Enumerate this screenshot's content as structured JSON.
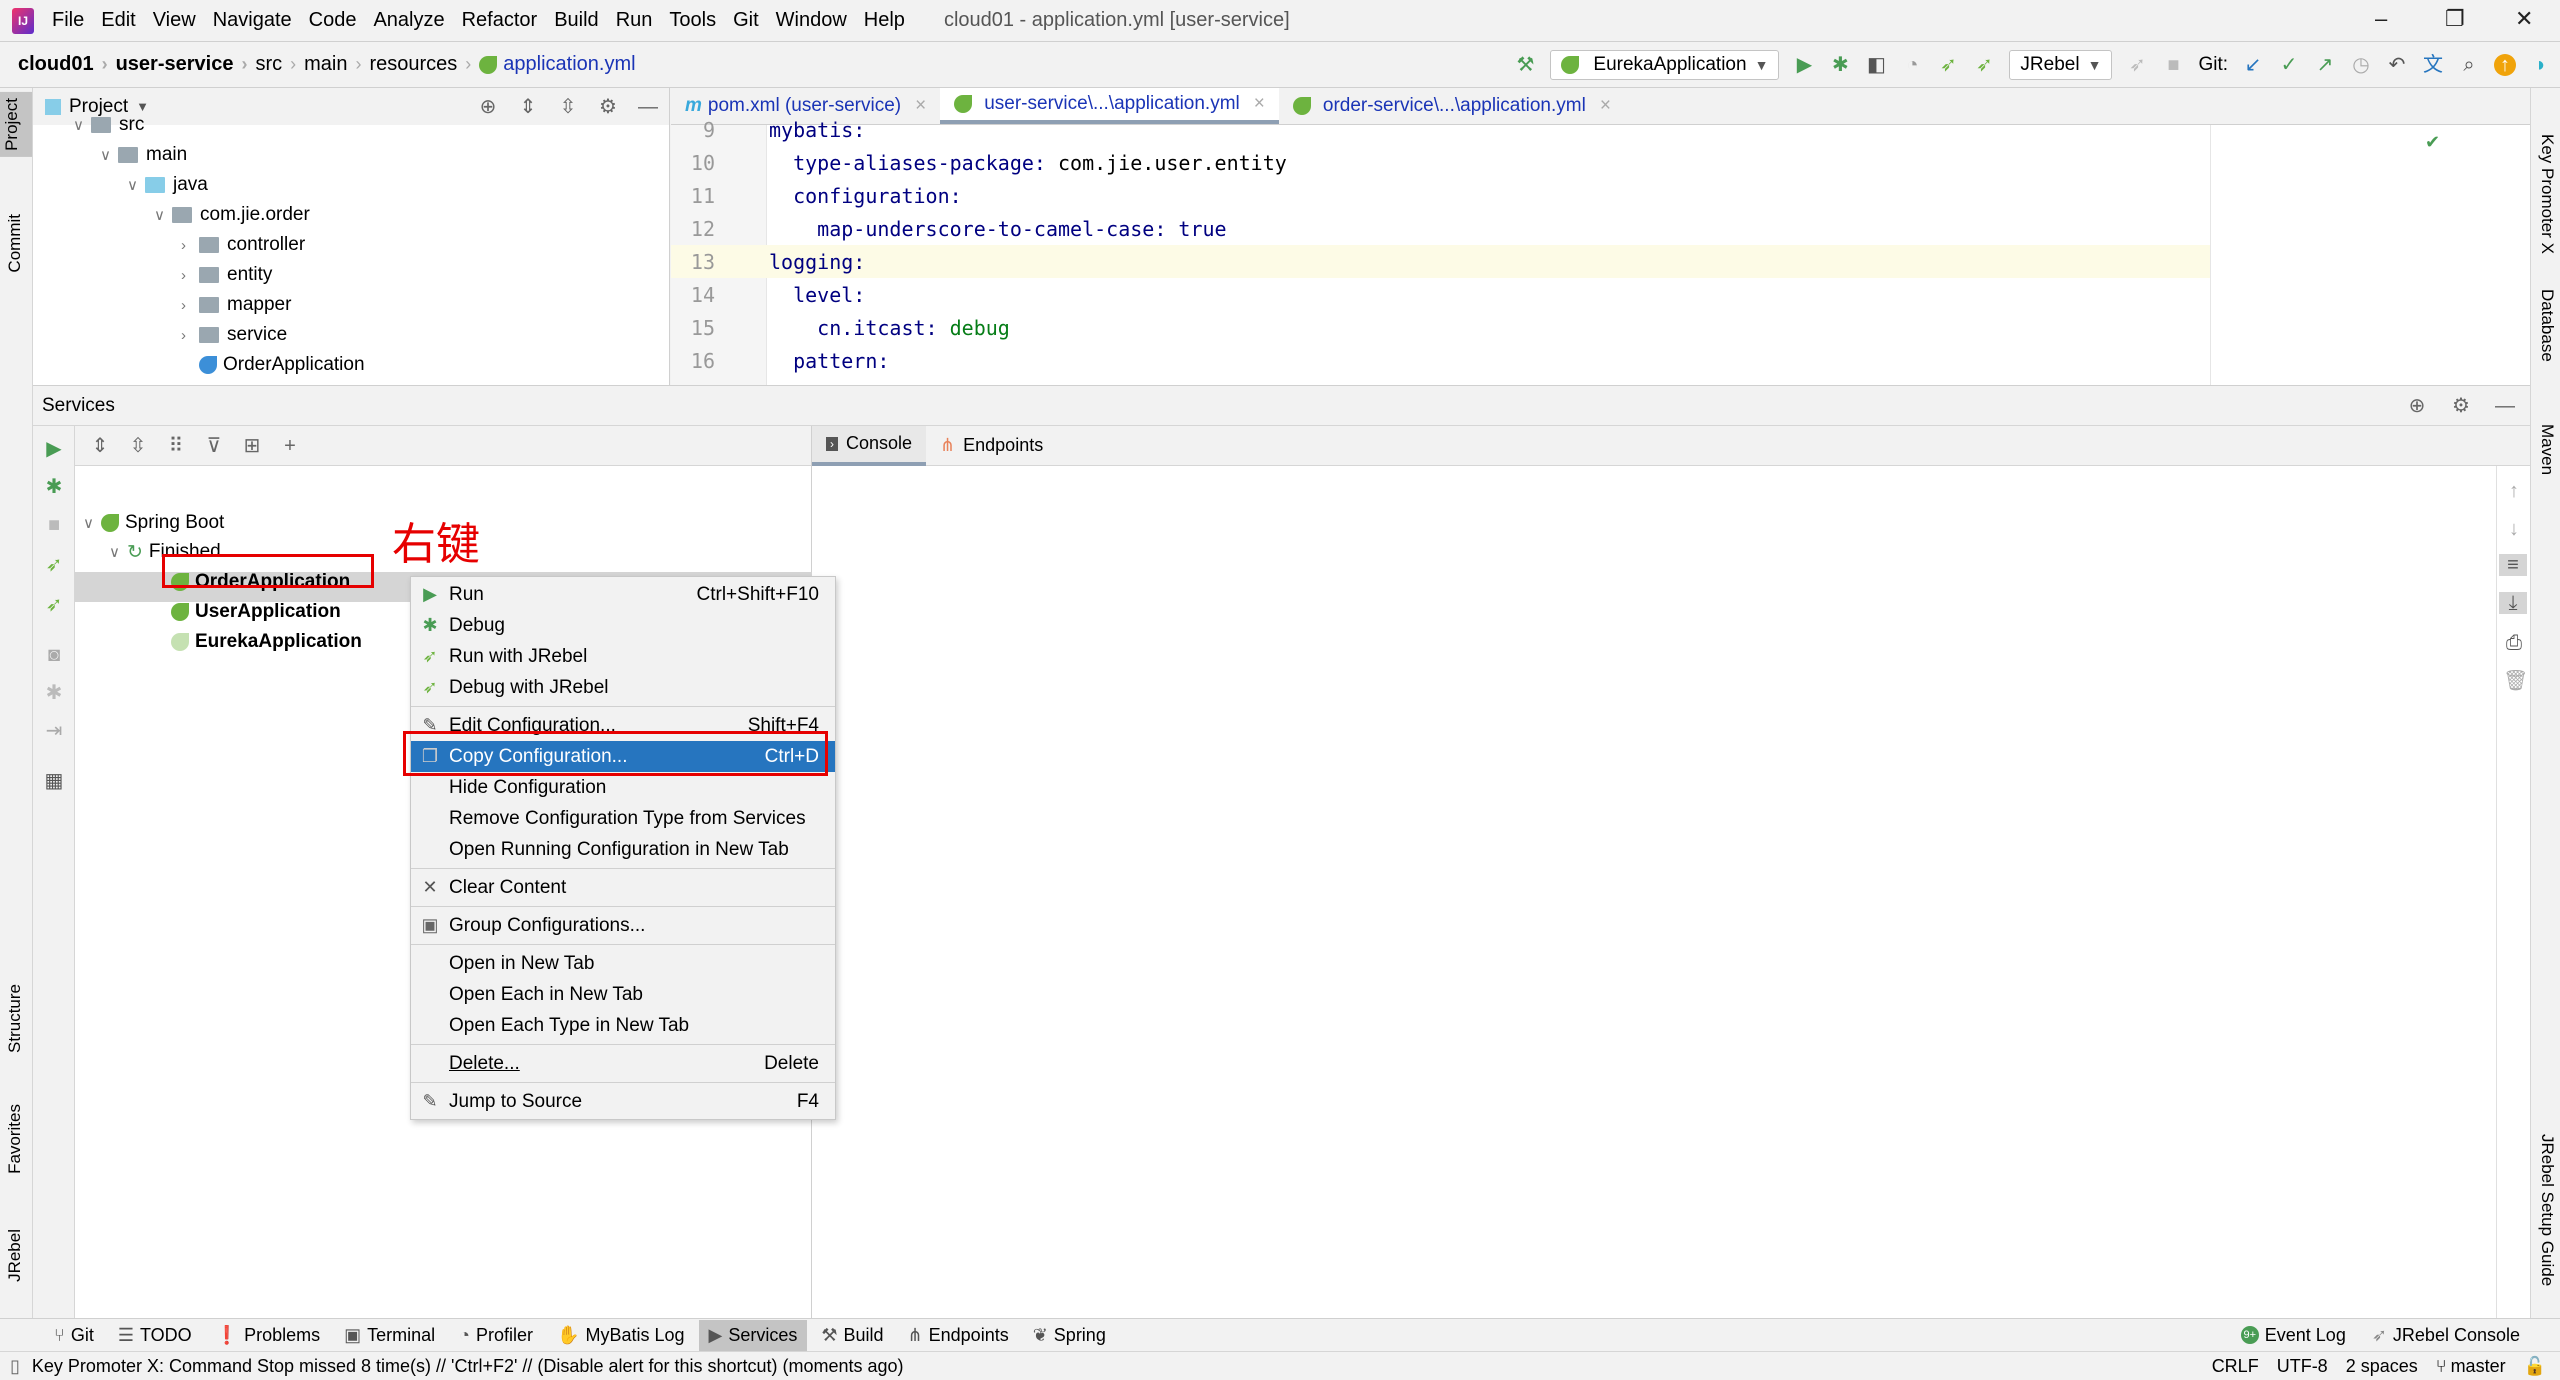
{
  "menubar": {
    "items": [
      "File",
      "Edit",
      "View",
      "Navigate",
      "Code",
      "Analyze",
      "Refactor",
      "Build",
      "Run",
      "Tools",
      "Git",
      "Window",
      "Help"
    ],
    "title": "cloud01 - application.yml [user-service]"
  },
  "breadcrumb": [
    "cloud01",
    "user-service",
    "src",
    "main",
    "resources",
    "application.yml"
  ],
  "toolbar": {
    "run_config": "EurekaApplication",
    "jrebel": "JRebel",
    "git_label": "Git:"
  },
  "project": {
    "title": "Project",
    "tree": [
      {
        "label": "src",
        "depth": 0,
        "type": "folder"
      },
      {
        "label": "main",
        "depth": 1,
        "type": "folder"
      },
      {
        "label": "java",
        "depth": 2,
        "type": "source"
      },
      {
        "label": "com.jie.order",
        "depth": 3,
        "type": "package"
      },
      {
        "label": "controller",
        "depth": 4,
        "type": "package"
      },
      {
        "label": "entity",
        "depth": 4,
        "type": "package"
      },
      {
        "label": "mapper",
        "depth": 4,
        "type": "package"
      },
      {
        "label": "service",
        "depth": 4,
        "type": "package"
      },
      {
        "label": "OrderApplication",
        "depth": 4,
        "type": "class"
      }
    ]
  },
  "editor": {
    "tabs": [
      "pom.xml (user-service)",
      "user-service\\...\\application.yml",
      "order-service\\...\\application.yml"
    ],
    "active_tab": 1,
    "lines": [
      {
        "n": "9",
        "key": "mybatis:",
        "val": "",
        "indent": 0
      },
      {
        "n": "10",
        "key": "type-aliases-package:",
        "val": " com.jie.user.entity",
        "indent": 1
      },
      {
        "n": "11",
        "key": "configuration:",
        "val": "",
        "indent": 1
      },
      {
        "n": "12",
        "key": "map-underscore-to-camel-case:",
        "val": " true",
        "indent": 2
      },
      {
        "n": "13",
        "key": "logging:",
        "val": "",
        "indent": 0
      },
      {
        "n": "14",
        "key": "level:",
        "val": "",
        "indent": 1
      },
      {
        "n": "15",
        "key": "cn.itcast:",
        "val": " debug",
        "indent": 2
      },
      {
        "n": "16",
        "key": "pattern:",
        "val": "",
        "indent": 1
      }
    ],
    "current_line": "13"
  },
  "services": {
    "title": "Services",
    "tree": {
      "root": "Spring Boot",
      "group": "Finished",
      "apps": [
        "OrderApplication",
        "UserApplication",
        "EurekaApplication"
      ],
      "selected": "UserApplication"
    },
    "console_tabs": [
      "Console",
      "Endpoints"
    ]
  },
  "annotation": "右键",
  "context_menu": {
    "items": [
      {
        "label": "Run",
        "shortcut": "Ctrl+Shift+F10",
        "icon": "run-icon"
      },
      {
        "label": "Debug",
        "shortcut": "",
        "icon": "debug-icon"
      },
      {
        "label": "Run with JRebel",
        "shortcut": "",
        "icon": "jrebel-run-icon"
      },
      {
        "label": "Debug with JRebel",
        "shortcut": "",
        "icon": "jrebel-debug-icon"
      },
      {
        "sep": true
      },
      {
        "label": "Edit Configuration...",
        "shortcut": "Shift+F4",
        "icon": "edit-icon"
      },
      {
        "label": "Copy Configuration...",
        "shortcut": "Ctrl+D",
        "icon": "copy-icon",
        "selected": true
      },
      {
        "label": "Hide Configuration",
        "shortcut": ""
      },
      {
        "label": "Remove Configuration Type from Services",
        "shortcut": ""
      },
      {
        "label": "Open Running Configuration in New Tab",
        "shortcut": ""
      },
      {
        "sep": true
      },
      {
        "label": "Clear Content",
        "shortcut": "",
        "icon": "clear-icon"
      },
      {
        "sep": true
      },
      {
        "label": "Group Configurations...",
        "shortcut": "",
        "icon": "group-icon"
      },
      {
        "sep": true
      },
      {
        "label": "Open in New Tab",
        "shortcut": ""
      },
      {
        "label": "Open Each in New Tab",
        "shortcut": ""
      },
      {
        "label": "Open Each Type in New Tab",
        "shortcut": ""
      },
      {
        "sep": true
      },
      {
        "label": "Delete...",
        "shortcut": "Delete"
      },
      {
        "sep": true
      },
      {
        "label": "Jump to Source",
        "shortcut": "F4",
        "icon": "edit-icon"
      }
    ]
  },
  "left_strip": [
    "Project",
    "Commit",
    "Structure",
    "Favorites",
    "JRebel"
  ],
  "right_strip": [
    "Key Promoter X",
    "Database",
    "Maven",
    "JRebel Setup Guide"
  ],
  "bottom_tools": [
    "Git",
    "TODO",
    "Problems",
    "Terminal",
    "Profiler",
    "MyBatis Log",
    "Services",
    "Build",
    "Endpoints",
    "Spring"
  ],
  "bottom_right": [
    "Event Log",
    "JRebel Console"
  ],
  "status": {
    "message": "Key Promoter X: Command Stop missed 8 time(s) // 'Ctrl+F2' // (Disable alert for this shortcut) (moments ago)",
    "line_sep": "CRLF",
    "encoding": "UTF-8",
    "indent": "2 spaces",
    "branch": "master"
  },
  "colors": {
    "accent": "#2675bf",
    "highlight_box": "#e60000",
    "spring": "#6db33f",
    "run": "#499c54"
  }
}
